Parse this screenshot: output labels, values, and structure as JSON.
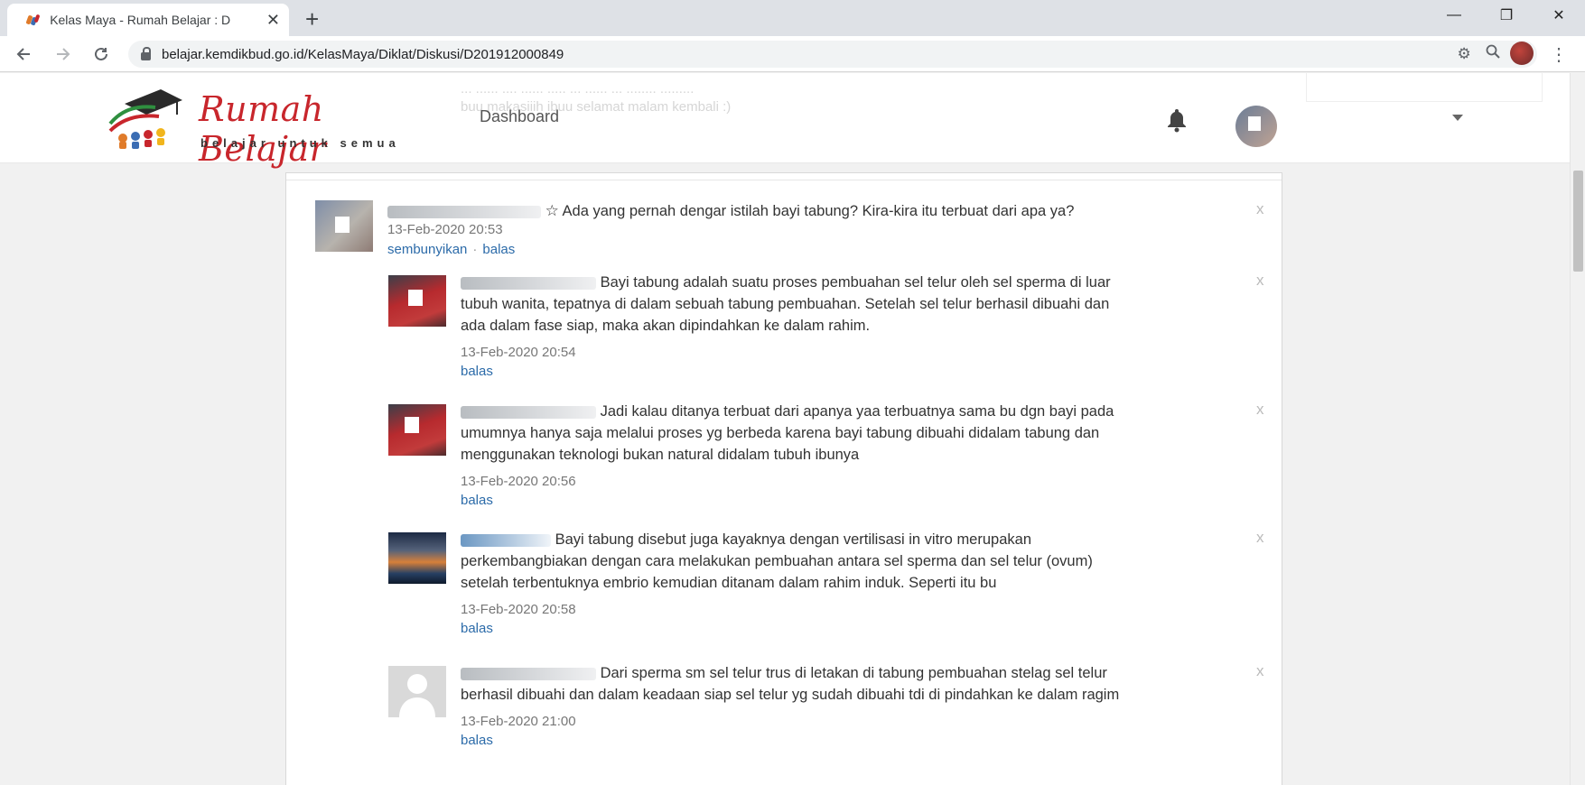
{
  "browser": {
    "tab_title": "Kelas Maya - Rumah Belajar : D",
    "tab_close": "✕",
    "new_tab": "+",
    "url": "belajar.kemdikbud.go.id/KelasMaya/Diklat/Diskusi/D201912000849",
    "window_controls": [
      "—",
      "❐",
      "✕"
    ]
  },
  "site": {
    "logo_text": "Rumah Belajar",
    "logo_tagline": "belajar untuk semua",
    "nav_dashboard": "Dashboard",
    "ghost_line1": "... ...... .... ...... ..... ... ...... ... ........ .........",
    "ghost_line2": "buu makasiiih ibuu selamat malam kembali :)"
  },
  "discussion": {
    "main_post": {
      "star": "☆",
      "text": "Ada yang pernah dengar istilah bayi tabung? Kira-kira itu terbuat dari apa ya?",
      "time": "13-Feb-2020 20:53",
      "link_hide": "sembunyikan",
      "sep": "·",
      "link_reply": "balas",
      "close": "x"
    },
    "replies": [
      {
        "line1": "Bayi tabung adalah suatu proses pembuahan sel telur oleh sel sperma di luar",
        "line2": "tubuh wanita, tepatnya di dalam sebuah tabung pembuahan. Setelah sel telur berhasil dibuahi dan",
        "line3": "ada dalam fase siap, maka akan dipindahkan ke dalam rahim.",
        "time": "13-Feb-2020 20:54",
        "reply": "balas",
        "close": "x"
      },
      {
        "line1": "Jadi kalau ditanya terbuat dari apanya yaa terbuatnya sama bu dgn bayi pada",
        "line2": "umumnya hanya saja melalui proses yg berbeda karena bayi tabung dibuahi didalam tabung dan",
        "line3": "menggunakan teknologi bukan natural didalam tubuh ibunya",
        "time": "13-Feb-2020 20:56",
        "reply": "balas",
        "close": "x"
      },
      {
        "line1": "Bayi tabung disebut juga kayaknya dengan vertilisasi in vitro merupakan",
        "line2": "perkembangbiakan dengan cara melakukan pembuahan antara sel sperma dan sel telur (ovum)",
        "line3": "setelah terbentuknya embrio kemudian ditanam dalam rahim induk. Seperti itu bu",
        "time": "13-Feb-2020 20:58",
        "reply": "balas",
        "close": "x"
      },
      {
        "line1": "Dari sperma sm sel telur trus di letakan di tabung pembuahan stelag sel telur",
        "line2": "berhasil dibuahi dan dalam keadaan siap sel telur yg sudah dibuahi tdi di pindahkan ke dalam ragim",
        "line3": "",
        "time": "13-Feb-2020 21:00",
        "reply": "balas",
        "close": "x"
      }
    ]
  }
}
